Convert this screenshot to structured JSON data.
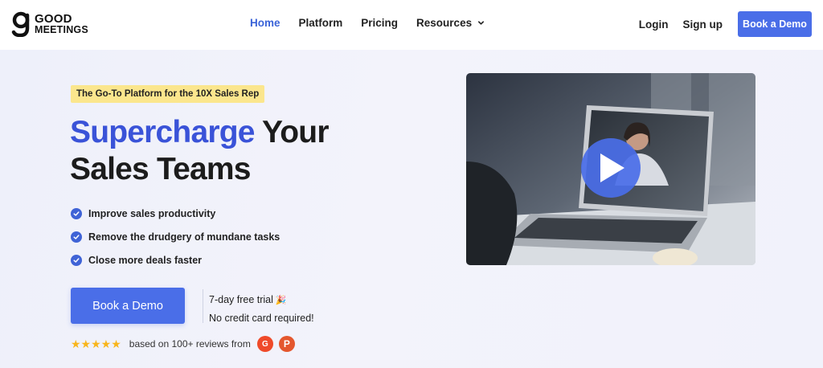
{
  "brand": {
    "logo_line1": "GOOD",
    "logo_line2": "MEETINGS",
    "accent": "#4a6ee8"
  },
  "nav": {
    "links": [
      "Home",
      "Platform",
      "Pricing",
      "Resources"
    ],
    "login": "Login",
    "signup": "Sign up",
    "demo": "Book a Demo"
  },
  "hero": {
    "badge": "The Go-To Platform for the 10X Sales Rep",
    "headline_highlight": "Supercharge",
    "headline_rest1": " Your",
    "headline_line2": "Sales Teams",
    "features": [
      "Improve sales productivity",
      "Remove the drudgery of mundane tasks",
      "Close more deals faster"
    ],
    "cta": "Book a Demo",
    "trial_line1": "7-day free trial",
    "trial_line2": "No credit card required!",
    "rating_stars": 5,
    "reviews_text": "based on 100+ reviews from",
    "review_sources": [
      "G",
      "P"
    ]
  },
  "icons": {
    "check": "check-circle-icon",
    "play": "play-icon",
    "chevron": "chevron-down-icon",
    "party": "party-popper-icon"
  }
}
